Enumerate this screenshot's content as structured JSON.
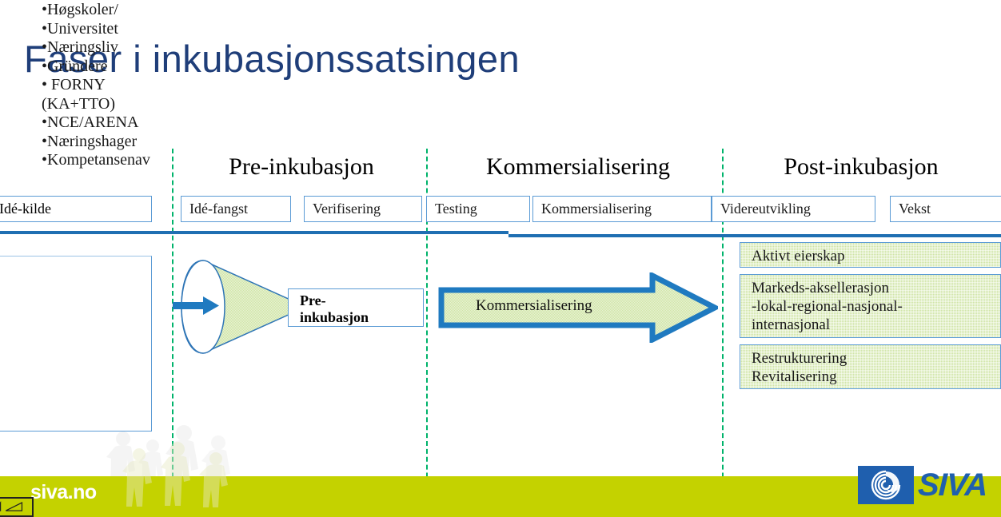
{
  "slide": {
    "title": "Faser i inkubasjonssatsingen",
    "accent_blue": "#1F3E79",
    "line_blue": "#1F6FB2",
    "box_border_blue": "#5B9BD5",
    "green_fill": "#CFE4A5",
    "divider_green": "#00B36B",
    "bar_green": "#C4D200"
  },
  "phases": [
    {
      "label": "Pre-inkubasjon"
    },
    {
      "label": "Kommersialisering"
    },
    {
      "label": "Post-inkubasjon"
    }
  ],
  "stages": [
    {
      "label": "Idé-fangst"
    },
    {
      "label": "Verifisering"
    },
    {
      "label": "Testing"
    },
    {
      "label": "Kommersialisering"
    },
    {
      "label": "Videreutvikling"
    },
    {
      "label": "Vekst"
    }
  ],
  "source_panel": {
    "header": "Idé-kilde",
    "items": [
      "•Høgskoler/",
      "•Universitet",
      "•Næringsliv",
      "•Gründere",
      "•  FORNY",
      "(KA+TTO)",
      "•NCE/ARENA",
      "•Næringshager",
      "•Kompetansenav"
    ]
  },
  "pre_incubation": {
    "box_label_line1": "Pre-",
    "box_label_line2": "inkubasjon"
  },
  "commercialization": {
    "arrow_label": "Kommersialisering"
  },
  "post_incubation": {
    "boxes": [
      {
        "lines": [
          "Aktivt eierskap"
        ]
      },
      {
        "lines": [
          "Markeds-aksellerasjon",
          "-lokal-regional-nasjonal-",
          "internasjonal"
        ]
      },
      {
        "lines": [
          "Restrukturering",
          "Revitalisering"
        ]
      }
    ]
  },
  "footer": {
    "site": "siva.no",
    "logo_word": "SIVA"
  }
}
